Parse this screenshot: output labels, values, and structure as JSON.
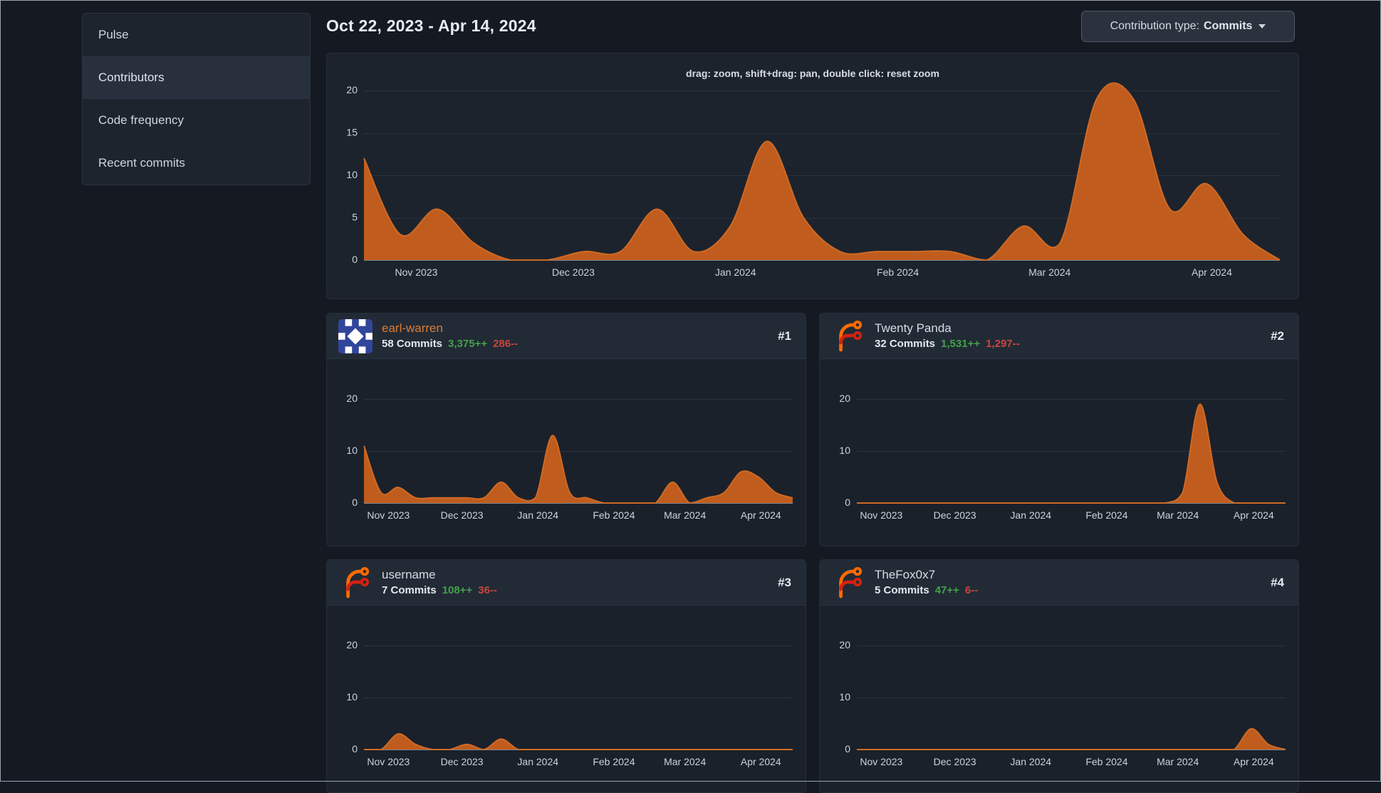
{
  "sidebar": {
    "items": [
      {
        "label": "Pulse",
        "active": false
      },
      {
        "label": "Contributors",
        "active": true
      },
      {
        "label": "Code frequency",
        "active": false
      },
      {
        "label": "Recent commits",
        "active": false
      }
    ]
  },
  "header": {
    "date_range": "Oct 22, 2023 - Apr 14, 2024",
    "contribution_type": {
      "label": "Contribution type:",
      "value": "Commits"
    }
  },
  "contributors": [
    {
      "rank": "#1",
      "name": "earl-warren",
      "commits": "58 Commits",
      "additions": "3,375++",
      "deletions": "286--",
      "avatar": "identicon",
      "name_color": "#dc7c33"
    },
    {
      "rank": "#2",
      "name": "Twenty Panda",
      "commits": "32 Commits",
      "additions": "1,531++",
      "deletions": "1,297--",
      "avatar": "forgejo-logo",
      "name_color": "#d6dce4"
    },
    {
      "rank": "#3",
      "name": "username",
      "commits": "7 Commits",
      "additions": "108++",
      "deletions": "36--",
      "avatar": "forgejo-logo",
      "name_color": "#d6dce4"
    },
    {
      "rank": "#4",
      "name": "TheFox0x7",
      "commits": "5 Commits",
      "additions": "47++",
      "deletions": "6--",
      "avatar": "forgejo-logo",
      "name_color": "#d6dce4"
    }
  ],
  "colors": {
    "page_bg": "#141922",
    "panel_bg": "#1c232d",
    "card_header_bg": "#222a35",
    "area_fill": "#c05c1d",
    "area_line": "#cf6a24",
    "grid": "#2c333e",
    "axis": "#7a8490",
    "tick_label": "#ccd3da",
    "green": "#44a04a",
    "red": "#c9463e",
    "accent_orange": "#dc7c33"
  },
  "chart_data": {
    "type": "area",
    "hint": "drag: zoom, shift+drag: pan, double click: reset zoom",
    "x": [
      "2023-10-22",
      "2023-10-29",
      "2023-11-05",
      "2023-11-12",
      "2023-11-19",
      "2023-11-26",
      "2023-12-03",
      "2023-12-10",
      "2023-12-17",
      "2023-12-24",
      "2023-12-31",
      "2024-01-07",
      "2024-01-14",
      "2024-01-21",
      "2024-01-28",
      "2024-02-04",
      "2024-02-11",
      "2024-02-18",
      "2024-02-25",
      "2024-03-03",
      "2024-03-10",
      "2024-03-17",
      "2024-03-24",
      "2024-03-31",
      "2024-04-07",
      "2024-04-14"
    ],
    "xticks": [
      {
        "label": "Nov 2023",
        "frac": 0.0571
      },
      {
        "label": "Dec 2023",
        "frac": 0.2286
      },
      {
        "label": "Jan 2024",
        "frac": 0.4057
      },
      {
        "label": "Feb 2024",
        "frac": 0.5829
      },
      {
        "label": "Mar 2024",
        "frac": 0.7486
      },
      {
        "label": "Apr 2024",
        "frac": 0.9257
      }
    ],
    "ylim": [
      0,
      20
    ],
    "legend": "none",
    "grid_on": true,
    "charts": [
      {
        "name": "all-contributions",
        "title": "Commits per week (all contributors)",
        "yticks": [
          0,
          5,
          10,
          15,
          20
        ],
        "values": [
          12,
          3,
          6,
          2,
          0,
          0,
          1,
          1,
          6,
          1,
          4,
          14,
          5,
          1,
          1,
          1,
          1,
          0,
          4,
          2,
          19,
          19,
          6,
          9,
          3,
          0
        ]
      },
      {
        "name": "earl-warren",
        "title": "earl-warren commits per week",
        "yticks": [
          0,
          10,
          20
        ],
        "values": [
          11,
          2,
          3,
          1,
          1,
          1,
          1,
          1,
          4,
          1,
          1,
          13,
          2,
          1,
          0,
          0,
          0,
          0,
          4,
          0,
          1,
          2,
          6,
          5,
          2,
          1
        ]
      },
      {
        "name": "Twenty Panda",
        "title": "Twenty Panda commits per week",
        "yticks": [
          0,
          10,
          20
        ],
        "values": [
          0,
          0,
          0,
          0,
          0,
          0,
          0,
          0,
          0,
          0,
          0,
          0,
          0,
          0,
          0,
          0,
          0,
          0,
          0,
          2,
          19,
          4,
          0,
          0,
          0,
          0
        ]
      },
      {
        "name": "username",
        "title": "username commits per week",
        "yticks": [
          0,
          10,
          20
        ],
        "values": [
          0,
          0,
          3,
          1,
          0,
          0,
          1,
          0,
          2,
          0,
          0,
          0,
          0,
          0,
          0,
          0,
          0,
          0,
          0,
          0,
          0,
          0,
          0,
          0,
          0,
          0
        ]
      },
      {
        "name": "TheFox0x7",
        "title": "TheFox0x7 commits per week",
        "yticks": [
          0,
          10,
          20
        ],
        "values": [
          0,
          0,
          0,
          0,
          0,
          0,
          0,
          0,
          0,
          0,
          0,
          0,
          0,
          0,
          0,
          0,
          0,
          0,
          0,
          0,
          0,
          0,
          0,
          4,
          1,
          0
        ]
      }
    ]
  }
}
